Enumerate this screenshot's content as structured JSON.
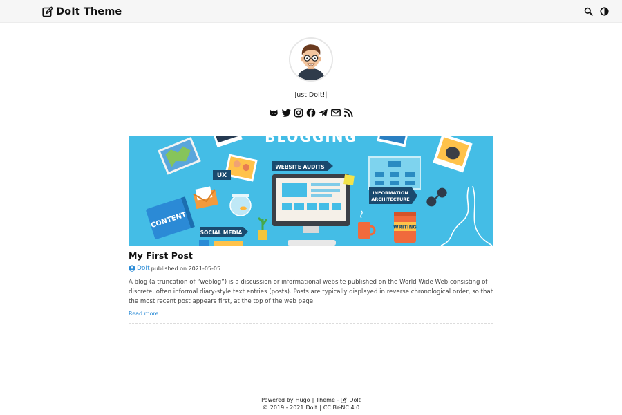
{
  "header": {
    "brand": "DoIt Theme",
    "icons": [
      "edit-icon",
      "search-icon",
      "theme-toggle-icon"
    ]
  },
  "profile": {
    "tagline": "Just DoIt!",
    "cursor": "|",
    "socials": [
      "github-icon",
      "twitter-icon",
      "instagram-icon",
      "facebook-icon",
      "telegram-icon",
      "email-icon",
      "rss-icon"
    ]
  },
  "cover": {
    "banner_text": "BLOGGING",
    "labels": {
      "ux": "UX",
      "website_audits": "WEBSITE AUDITS",
      "information_architecture_1": "INFORMATION",
      "information_architecture_2": "ARCHITECTURE",
      "content": "CONTENT",
      "social_media": "SOCIAL MEDIA",
      "writing": "WRITING"
    }
  },
  "post": {
    "title": "My First Post",
    "author": "DoIt",
    "published": "published on 2021-05-05",
    "summary": "A blog (a truncation of “weblog”) is a discussion or informational website published on the World Wide Web consisting of discrete, often informal diary-style text entries (posts). Posts are typically displayed in reverse chronological order, so that the most recent post appears first, at the top of the web page.",
    "read_more": "Read more..."
  },
  "footer": {
    "powered_prefix": "Powered by",
    "hugo": "Hugo",
    "sep": "|",
    "theme_prefix": "Theme -",
    "theme_name": "DoIt",
    "copyright_symbol": "©",
    "years": "2019 - 2021",
    "owner": "DoIt",
    "license": "CC BY-NC 4.0"
  },
  "colors": {
    "banner": "#44bde6",
    "accent": "#2a8bd6",
    "navbar": "#f6f6f6"
  }
}
